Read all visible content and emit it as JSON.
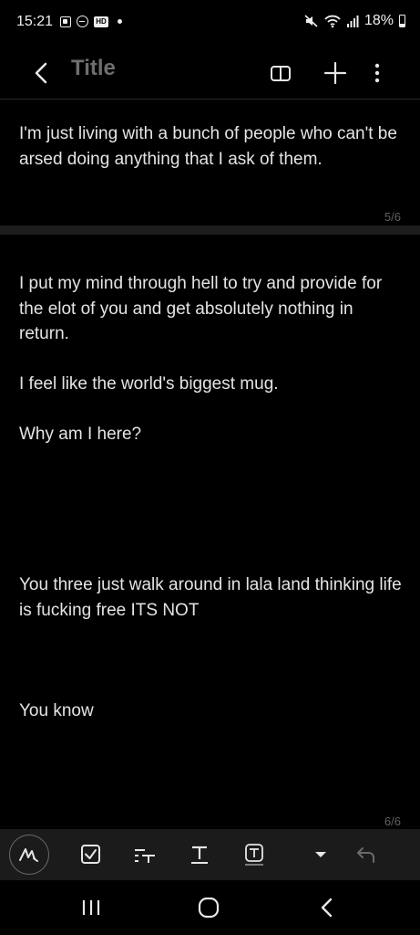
{
  "status_bar": {
    "time": "15:21",
    "battery": "18%",
    "icons": [
      "notification-icon",
      "do-not-disturb-icon",
      "hd-icon",
      "dot-icon",
      "mute-icon",
      "wifi-icon",
      "signal-icon",
      "battery-icon"
    ]
  },
  "app_bar": {
    "title": "Title",
    "icons": [
      "back-icon",
      "book-view-icon",
      "add-icon",
      "more-options-icon"
    ]
  },
  "pages": [
    {
      "text": "I'm just living with a bunch of people who can't be arsed doing anything that I ask of them.",
      "page_number": "5/6"
    },
    {
      "text": "I put my mind through hell to try and provide for the elot of you and get absolutely nothing in return.\n\nI feel like the world's biggest mug.\n\nWhy am I here?\n\n\n\n\n\nYou three just walk around in lala land thinking life is fucking free ITS NOT\n\n\n\nYou know",
      "page_number": "6/6"
    }
  ],
  "toolbar": {
    "icons": [
      "handwriting-pen-icon",
      "checkbox-icon",
      "text-style-icon",
      "text-underline-icon",
      "text-box-icon",
      "dropdown-arrow-icon",
      "undo-icon"
    ]
  },
  "nav_bar": {
    "icons": [
      "recent-apps-icon",
      "home-icon",
      "back-nav-icon"
    ]
  },
  "colors": {
    "background": "#000000",
    "text": "#e4e4e4",
    "title": "#6e6e6e",
    "toolbar_bg": "#1b1b1b",
    "page_separator": "#1d1d1d"
  }
}
